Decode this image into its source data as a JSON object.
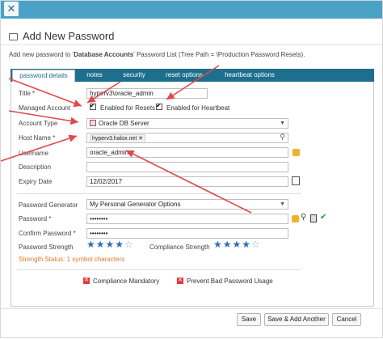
{
  "window": {
    "close_glyph": "✕"
  },
  "dialog": {
    "title": "Add New Password",
    "icon": "password-list-icon"
  },
  "intro": {
    "prefix": "Add new password to '",
    "list_name": "Database Accounts",
    "suffix": "' Password List (Tree Path = \\Production Password Resets)."
  },
  "tabs": [
    "password details",
    "notes",
    "security",
    "reset options",
    "heartbeat options"
  ],
  "form": {
    "title_label": "Title *",
    "title_value": "hyperv3\\oracle_admin",
    "managed_label": "Managed Account",
    "enabled_resets": "Enabled for Resets",
    "enabled_heartbeat": "Enabled for Heartbeat",
    "account_type_label": "Account Type",
    "account_type_value": "Oracle DB Server",
    "host_label": "Host Name *",
    "host_value": "hyperv3.halox.net",
    "username_label": "Username",
    "username_value": "oracle_admin",
    "description_label": "Description",
    "description_value": "",
    "expiry_label": "Expiry Date",
    "expiry_value": "12/02/2017",
    "generator_label": "Password Generator",
    "generator_value": "My Personal Generator Options",
    "password_label": "Password *",
    "password_value": "••••••••",
    "confirm_label": "Confirm Password *",
    "confirm_value": "••••••••",
    "strength_label": "Password Strength",
    "compliance_strength_label": "Compliance Strength",
    "strength_status": "Strength Status: 1 symbol characters",
    "compliance_mandatory": "Compliance Mandatory",
    "prevent_bad": "Prevent Bad Password Usage"
  },
  "ratings": {
    "password_strength": 4,
    "compliance_strength": 4,
    "max": 5
  },
  "buttons": {
    "save": "Save",
    "save_add": "Save & Add Another",
    "cancel": "Cancel"
  },
  "colors": {
    "accent": "#1e6e8e",
    "titlebar": "#4aa3c7",
    "annotation_arrow": "#e04a4a",
    "star": "#2f6fb5",
    "warning_text": "#e07a2a"
  }
}
